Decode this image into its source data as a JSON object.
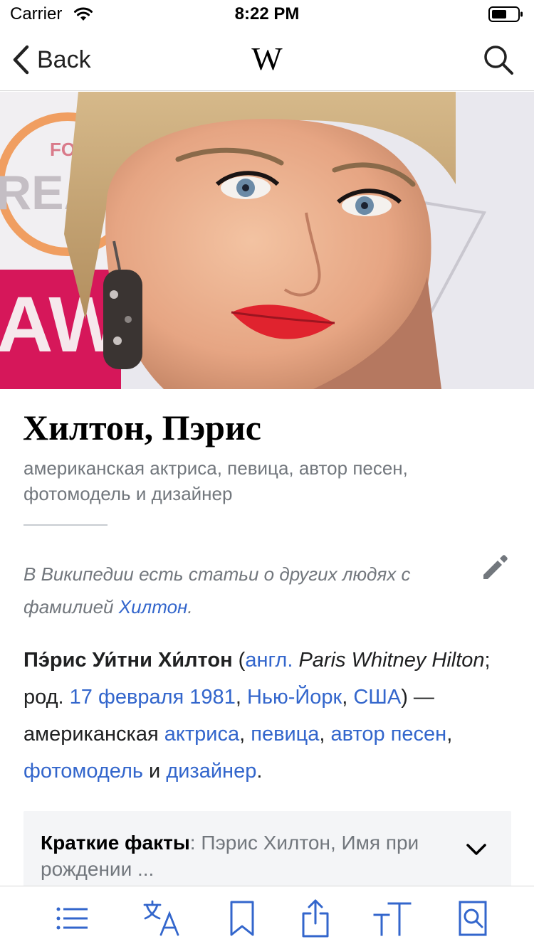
{
  "status_bar": {
    "carrier": "Carrier",
    "time": "8:22 PM"
  },
  "nav": {
    "back_label": "Back",
    "logo": "W"
  },
  "article": {
    "title": "Хилтон, Пэрис",
    "description": "американская актриса, певица, автор песен, фотомодель и дизайнер",
    "hatnote": {
      "text": "В Википедии есть статьи о других людях с фамилией ",
      "link": "Хилтон",
      "end": "."
    },
    "lead": {
      "name": "Пэ́рис Уи́тни Хи́лтон",
      "open": " (",
      "lang_link": "англ.",
      "orig_name": " Paris Whitney Hilton",
      "born": "; род. ",
      "date_link": "17 февраля 1981",
      "sep1": ", ",
      "city_link": "Нью-Йорк",
      "sep2": ", ",
      "country_link": "США",
      "dash": ") — американская ",
      "link_actress": "актриса",
      "sep3": ", ",
      "link_singer": "певица",
      "sep4": ", ",
      "link_songwriter": "автор песен",
      "sep5": ", ",
      "link_model": "фотомодель",
      "and": " и ",
      "link_designer": "дизайнер",
      "end": "."
    },
    "infobox": {
      "label": "Краткие факты",
      "summary": ": Пэрис Хилтон, Имя при рождении ..."
    }
  },
  "colors": {
    "link": "#3366cc",
    "secondary_text": "#72777d",
    "body_text": "#202122"
  },
  "toolbar": {
    "items": [
      "contents-icon",
      "language-icon",
      "bookmark-icon",
      "share-icon",
      "text-size-icon",
      "find-in-page-icon"
    ]
  }
}
